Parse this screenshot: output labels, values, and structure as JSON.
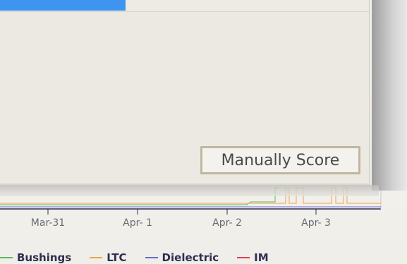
{
  "dialog": {
    "progress_percent": 34,
    "progress_color": "#3d95f0",
    "manual_score_label": "Manually Score"
  },
  "chart": {
    "x_ticks": [
      "Mar-31",
      "Apr- 1",
      "Apr- 2",
      "Apr- 3"
    ],
    "legend": [
      {
        "name": "Bushings",
        "color": "#5cb85c"
      },
      {
        "name": "LTC",
        "color": "#f0a050"
      },
      {
        "name": "Dielectric",
        "color": "#6a6ad0"
      },
      {
        "name": "IM",
        "color": "#e04050"
      }
    ]
  }
}
